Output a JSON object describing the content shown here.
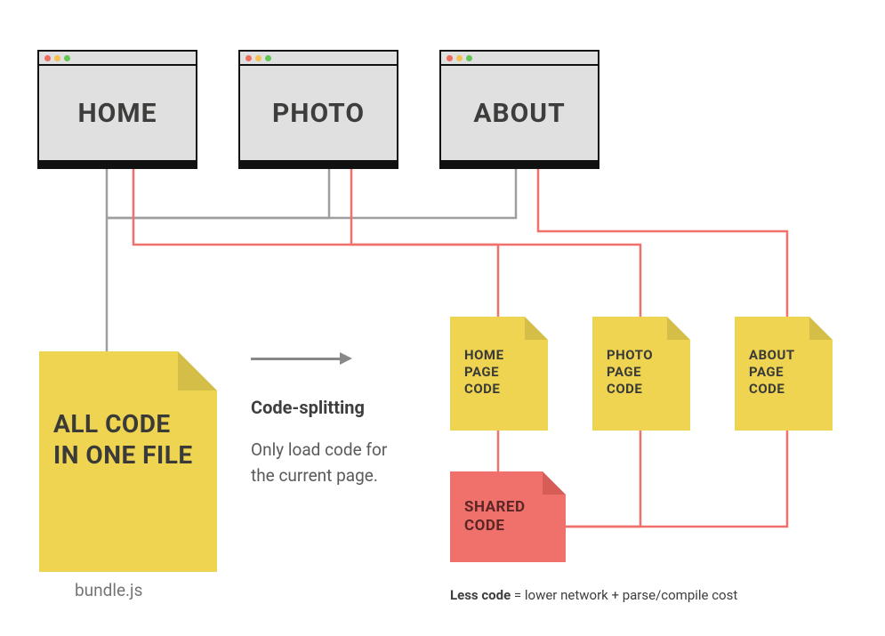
{
  "browsers": {
    "home": "HOME",
    "photo": "PHOTO",
    "about": "ABOUT"
  },
  "bundle": {
    "text": "ALL CODE IN ONE FILE",
    "filename": "bundle.js"
  },
  "splitting": {
    "title": "Code-splitting",
    "desc": "Only load code for the current page."
  },
  "chunks": {
    "home": "HOME PAGE CODE",
    "photo": "PHOTO PAGE CODE",
    "about": "ABOUT PAGE CODE",
    "shared": "SHARED CODE"
  },
  "footer": {
    "bold": "Less code",
    "rest": " = lower network + parse/compile cost"
  }
}
